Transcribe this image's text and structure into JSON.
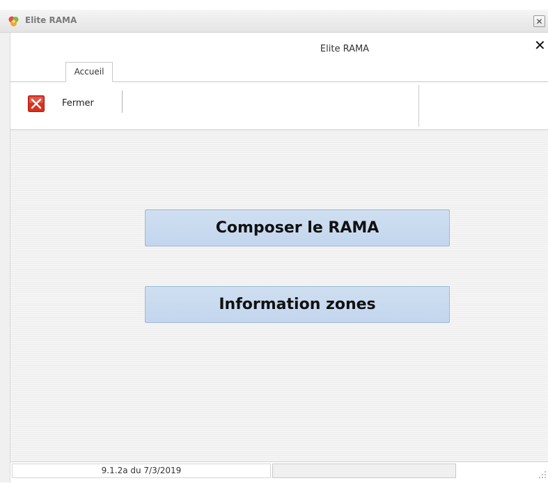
{
  "window": {
    "title": "Elite RAMA",
    "close_glyph": "✕"
  },
  "ribbon": {
    "title": "Elite RAMA",
    "close_glyph": "✕",
    "tabs": [
      {
        "label": "Accueil",
        "active": true
      }
    ]
  },
  "toolbar": {
    "fermer_label": "Fermer",
    "fermer_icon": "close-red-square-icon"
  },
  "main": {
    "buttons": [
      {
        "label": "Composer le RAMA"
      },
      {
        "label": "Information zones"
      }
    ]
  },
  "statusbar": {
    "version": "9.1.2a du 7/3/2019"
  },
  "colors": {
    "button_fill": "#c9dbf0",
    "button_border": "#9fb8d6",
    "close_icon_red": "#d9301f"
  }
}
